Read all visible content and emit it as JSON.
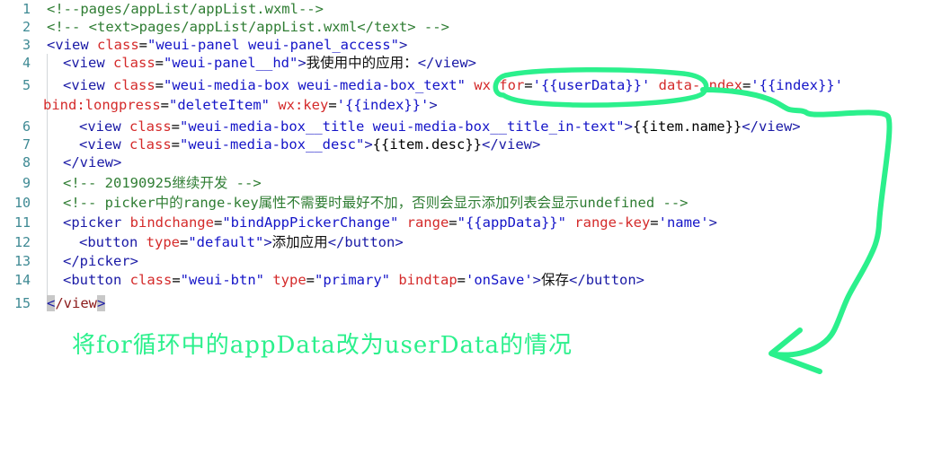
{
  "editor": {
    "language": "wxml",
    "theme_background": "#ffffff",
    "line_number_color": "#3f8a94",
    "lines": [
      {
        "num": "1",
        "wrapped": false
      },
      {
        "num": "2",
        "wrapped": false
      },
      {
        "num": "3",
        "wrapped": false
      },
      {
        "num": "4",
        "wrapped": false
      },
      {
        "num": "5",
        "wrapped": true
      },
      {
        "num": "6",
        "wrapped": false
      },
      {
        "num": "7",
        "wrapped": false
      },
      {
        "num": "8",
        "wrapped": false
      },
      {
        "num": "9",
        "wrapped": false
      },
      {
        "num": "10",
        "wrapped": false
      },
      {
        "num": "11",
        "wrapped": false
      },
      {
        "num": "12",
        "wrapped": false
      },
      {
        "num": "13",
        "wrapped": false
      },
      {
        "num": "14",
        "wrapped": false
      },
      {
        "num": "15",
        "wrapped": false
      }
    ],
    "code": {
      "l1": "<!--pages/appList/appList.wxml-->",
      "l2": "<!-- <text>pages/appList/appList.wxml</text> -->",
      "l3_tag_open": "<view ",
      "l3_attr": "class",
      "l3_eq": "=",
      "l3_val": "\"weui-panel weui-panel_access\"",
      "l3_close": ">",
      "l4_tag_open": "<view ",
      "l4_attr": "class",
      "l4_eq": "=",
      "l4_val": "\"weui-panel__hd\"",
      "l4_gt": ">",
      "l4_cjk": "我使用中的应用：",
      "l4_end": "</view>",
      "l5_tag_open": "<view ",
      "l5_attr1": "class",
      "l5_eq1": "=",
      "l5_val1": "\"weui-media-box weui-media-box_text\"",
      "l5_attr2": " wx:for",
      "l5_eq2": "=",
      "l5_val2": "'{{userData}}'",
      "l5_attr3": " data-index",
      "l5_eq3": "=",
      "l5_val3": "'{{index}}'",
      "l5b_attr1": "bind:longpress",
      "l5b_eq1": "=",
      "l5b_val1": "\"deleteItem\"",
      "l5b_attr2": " wx:key",
      "l5b_eq2": "=",
      "l5b_val2": "'{{index}}'",
      "l5b_gt": ">",
      "l6_tag_open": "<view ",
      "l6_attr": "class",
      "l6_eq": "=",
      "l6_val": "\"weui-media-box__title weui-media-box__title_in-text\"",
      "l6_gt": ">",
      "l6_mustache": "{{item.name}}",
      "l6_end": "</view>",
      "l7_tag_open": "<view ",
      "l7_attr": "class",
      "l7_eq": "=",
      "l7_val": "\"weui-media-box__desc\"",
      "l7_gt": ">",
      "l7_mustache": "{{item.desc}}",
      "l7_end": "</view>",
      "l8": "</view>",
      "l9_a": "<!-- 20190925",
      "l9_cjk": "继续开发",
      "l9_b": " -->",
      "l10_a": "<!-- picker",
      "l10_cjk1": "中的",
      "l10_b": "range-key",
      "l10_cjk2": "属性不需要时最好不加，否则会显示添加列表会显示",
      "l10_c": "undefined -->",
      "l11_tag_open": "<picker ",
      "l11_attr1": "bindchange",
      "l11_eq1": "=",
      "l11_val1": "\"bindAppPickerChange\"",
      "l11_attr2": " range",
      "l11_eq2": "=",
      "l11_val2": "\"{{appData}}\"",
      "l11_attr3": " range-key",
      "l11_eq3": "=",
      "l11_val3": "'name'",
      "l11_gt": ">",
      "l12_tag_open": "<button ",
      "l12_attr": "type",
      "l12_eq": "=",
      "l12_val": "\"default\"",
      "l12_gt": ">",
      "l12_cjk": "添加应用",
      "l12_end": "</button>",
      "l13": "</picker>",
      "l14_tag_open": "<button ",
      "l14_attr1": "class",
      "l14_eq1": "=",
      "l14_val1": "\"weui-btn\"",
      "l14_attr2": " type",
      "l14_eq2": "=",
      "l14_val2": "\"primary\"",
      "l14_attr3": " bindtap",
      "l14_eq3": "=",
      "l14_val3": "'onSave'",
      "l14_gt": ">",
      "l14_cjk": "保存",
      "l14_end": "</button>",
      "l15_lt": "<",
      "l15_name": "/view",
      "l15_gt": ">"
    }
  },
  "annotation": {
    "color": "#2bf08c",
    "caption": "将for循环中的appData改为userData的情况",
    "highlighted_code": "wx:for='{{userData}}'",
    "shapes": [
      "ellipse-circle",
      "curved-arrow"
    ]
  }
}
